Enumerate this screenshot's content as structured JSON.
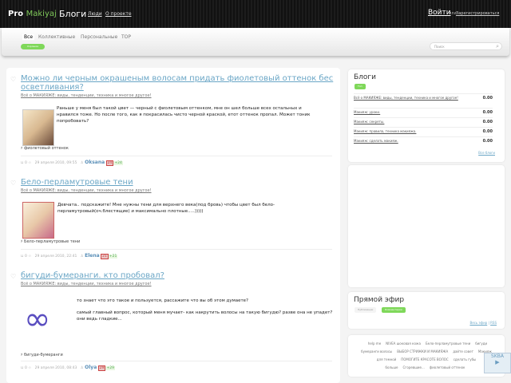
{
  "header": {
    "logo_pre": "Pro",
    "logo_post": "Makiyaj",
    "blogs": "Блоги",
    "people": "Люди",
    "about": "О проекте",
    "login": "Войти",
    "or": "или",
    "register": "Зарегистрироваться"
  },
  "subnav": {
    "tabs": [
      "Все",
      "Коллективные",
      "Персональные",
      "TOP"
    ],
    "badge": "Хорошие",
    "search_placeholder": "Поиск"
  },
  "posts": [
    {
      "title": "Можно ли черным окрашеным волосам придать фиолетовый оттенок бес осветливания?",
      "blog": "Всё о МАКИЯЖЕ: виды, тенденции, техника и многое другое!",
      "text": "Раньше у меня был такой цвет — черный с фиолетовым оттенком, мне он шел больше всех остальных и нравился тоже. Но после того, как я покрасилась чисто черной краской, етот оттенок пропал. Может тоник попробовать?",
      "tag": "фиолетовый оттенок",
      "rating": "0",
      "date": "29 апреля 2010, 09:55",
      "author": "Oksana",
      "count": "24",
      "plus": "+24"
    },
    {
      "title": "Бело-перламутровые тени",
      "blog": "Всё о МАКИЯЖЕ: виды, тенденции, техника и многое другое!",
      "text": "Девчата.. подскажите! Мне нужны тени для верхнего века(под бровь) чтобы цвет был бело-перламутровый(оч.блестящие) и максимально плотные.....)))))",
      "tag": "Бело-перламутровые тени",
      "rating": "0",
      "date": "29 апреля 2010, 22:41",
      "author": "Elena",
      "count": "21",
      "plus": "+21"
    },
    {
      "title": "бигуди-бумеранги. кто пробовал?",
      "blog": "Всё о МАКИЯЖЕ: виды, тенденции, техника и многое другое!",
      "text": "то знает что это такое и пользуется, рассажите что вы об этом думаете?",
      "text2": "самый главный вопрос, который меня мучает- как накрутить волосы на такую бигудю? разве она не упадет? они ведь гладкие...",
      "tag": "бигуди-бумеранги",
      "rating": "0",
      "date": "29 апреля 2010, 08:43",
      "author": "Olya",
      "count": "29",
      "plus": "+29"
    }
  ],
  "sidebar": {
    "blogs_title": "Блоги",
    "blogs_btn": "Топ",
    "blogs": [
      {
        "name": "Всё о МАКИЯЖЕ: виды, тенденции, техника и многое другое!",
        "rating": "0.00"
      },
      {
        "name": "Макияж: уроки.",
        "rating": "0.00"
      },
      {
        "name": "Макияж: секреты.",
        "rating": "0.00"
      },
      {
        "name": "Макияж: правила, техника макияжа.",
        "rating": "0.00"
      },
      {
        "name": "Макияж: сделать макияж.",
        "rating": "0.00"
      }
    ],
    "all_blogs": "Все блоги",
    "live_title": "Прямой эфир",
    "live_tabs": [
      "Публикации",
      "Комментарии"
    ],
    "live_all": "Весь эфир",
    "rss": "RSS",
    "tags": [
      "help me",
      "NIVEA шоковая кожа",
      "Бело-перламутровые тени",
      "бигуди бумеранги волосы",
      "ВЫБОР СТРИЖКИ И МАКИЯЖА",
      "дайте совет",
      "Макияж для темной",
      "ПОМОГИТЕ КРАСОТЕ ВОЛОС",
      "сделать губы больше",
      "Сгоревшие...",
      "фиолетовый оттенок"
    ]
  },
  "widget": "SKBA"
}
